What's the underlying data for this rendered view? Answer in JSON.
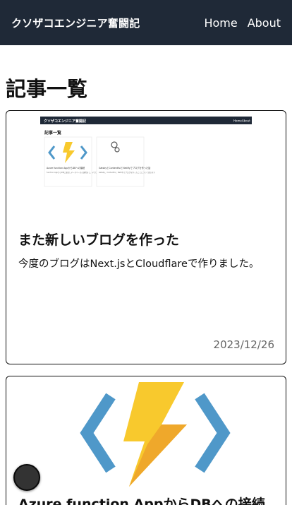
{
  "header": {
    "brand": "クソザコエンジニア奮闘記",
    "nav": [
      {
        "label": "Home"
      },
      {
        "label": "About"
      }
    ]
  },
  "main": {
    "title": "記事一覧",
    "posts": [
      {
        "title": "また新しいブログを作った",
        "description": "今度のブログはNext.jsとCloudflareで作りました。",
        "date": "2023/12/26",
        "thumbnail": {
          "header_brand": "クソザコエンジニア奮闘記",
          "header_nav": [
            "Home",
            "About"
          ],
          "page_title": "記事一覧",
          "cards": [
            {
              "title": "Azure function AppからDBへの接続",
              "text": "function AppからDBに接続しデータベースの連携をし、デプロイまでの流れを紹介"
            },
            {
              "title": "GatsbyとContentfulとNetlifyでブログを作った話",
              "text": "Gatsby、Contentful、Netlifyでブログを作ったことについて書きます"
            }
          ]
        }
      },
      {
        "title": "Azure function AppからDBへの接続",
        "icon": "azure-functions-icon"
      }
    ]
  },
  "colors": {
    "navbar": "#1f2937",
    "bolt_yellow": "#f8c92d",
    "bolt_orange": "#efa82b",
    "bracket_blue": "#4f98c9",
    "date_gray": "#666666"
  }
}
